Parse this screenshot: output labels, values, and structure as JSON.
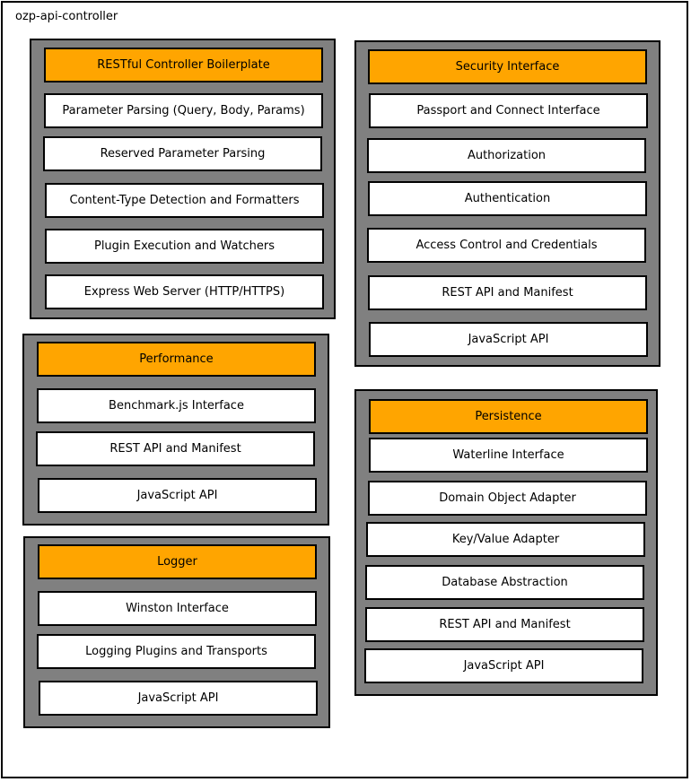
{
  "diagram": {
    "title": "ozp-api-controller",
    "colors": {
      "header": "#ffa500",
      "group": "#808080",
      "box": "#ffffff",
      "border": "#000000"
    },
    "groups": {
      "restful": {
        "header": "RESTful Controller Boilerplate",
        "items": [
          "Parameter Parsing (Query, Body, Params)",
          "Reserved Parameter Parsing",
          "Content-Type Detection and Formatters",
          "Plugin Execution and Watchers",
          "Express Web Server (HTTP/HTTPS)"
        ]
      },
      "security": {
        "header": "Security Interface",
        "items": [
          "Passport and Connect Interface",
          "Authorization",
          "Authentication",
          "Access Control and Credentials",
          "REST API and Manifest",
          "JavaScript API"
        ]
      },
      "performance": {
        "header": "Performance",
        "items": [
          "Benchmark.js Interface",
          "REST API and Manifest",
          "JavaScript API"
        ]
      },
      "persistence": {
        "header": "Persistence",
        "items": [
          "Waterline Interface",
          "Domain Object Adapter",
          "Key/Value Adapter",
          "Database Abstraction",
          "REST API and Manifest",
          "JavaScript API"
        ]
      },
      "logger": {
        "header": "Logger",
        "items": [
          "Winston Interface",
          "Logging Plugins and Transports",
          "JavaScript API"
        ]
      }
    }
  }
}
